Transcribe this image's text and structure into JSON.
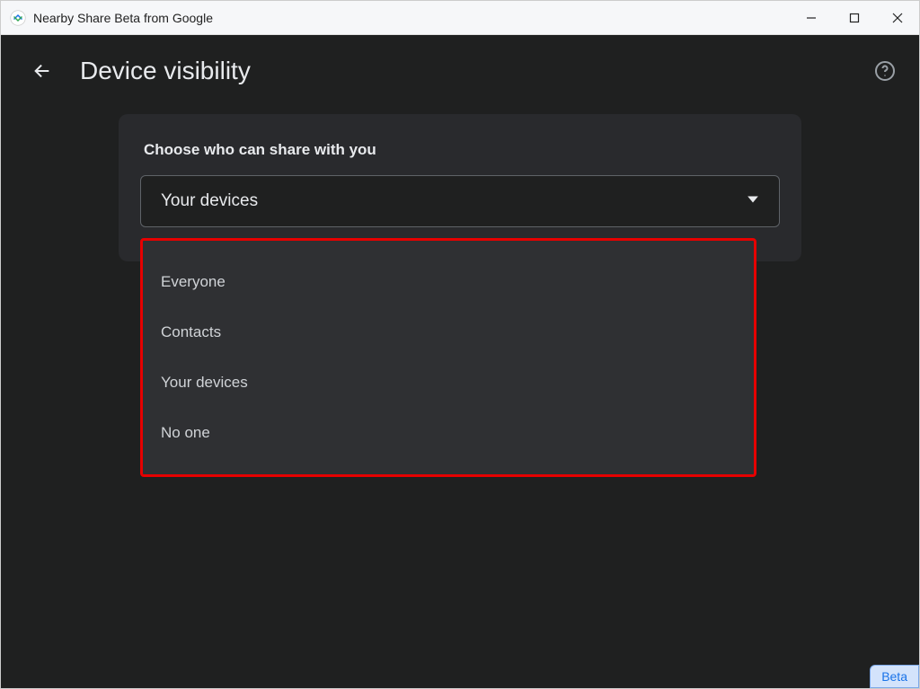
{
  "window": {
    "title": "Nearby Share Beta from Google"
  },
  "header": {
    "title": "Device visibility"
  },
  "panel": {
    "label": "Choose who can share with you",
    "selected": "Your devices"
  },
  "dropdown": {
    "items": [
      "Everyone",
      "Contacts",
      "Your devices",
      "No one"
    ]
  },
  "badge": {
    "beta": "Beta"
  }
}
